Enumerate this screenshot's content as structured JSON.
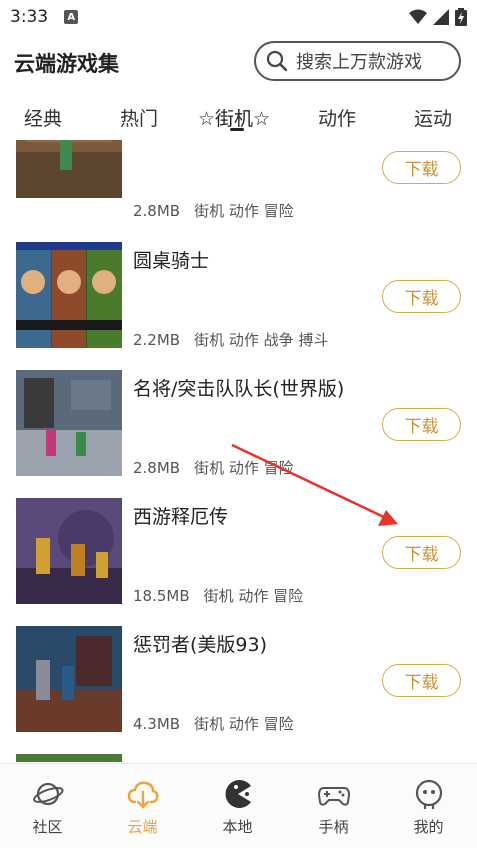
{
  "status_bar": {
    "time": "3:33",
    "notification_glyph": "A"
  },
  "header": {
    "title": "云端游戏集",
    "search_placeholder": "搜索上万款游戏"
  },
  "tabs": [
    {
      "label": "经典"
    },
    {
      "label": "热门"
    },
    {
      "label": "☆街机☆"
    },
    {
      "label": "动作"
    },
    {
      "label": "运动"
    }
  ],
  "games": [
    {
      "name": "",
      "size": "2.8MB",
      "tags": "街机 动作 冒险",
      "download": "下载"
    },
    {
      "name": "圆桌骑士",
      "size": "2.2MB",
      "tags": "街机 动作 战争 搏斗",
      "download": "下载"
    },
    {
      "name": "名将/突击队队长(世界版)",
      "size": "2.8MB",
      "tags": "街机 动作 冒险",
      "download": "下载"
    },
    {
      "name": "西游释厄传",
      "size": "18.5MB",
      "tags": "街机 动作 冒险",
      "download": "下载"
    },
    {
      "name": "惩罚者(美版93)",
      "size": "4.3MB",
      "tags": "街机 动作 冒险",
      "download": "下载"
    },
    {
      "name": "",
      "size": "",
      "tags": "",
      "download": ""
    }
  ],
  "bottom_nav": [
    {
      "label": "社区",
      "icon": "planet-icon"
    },
    {
      "label": "云端",
      "icon": "cloud-download-icon",
      "active": true
    },
    {
      "label": "本地",
      "icon": "pacman-icon"
    },
    {
      "label": "手柄",
      "icon": "gamepad-icon"
    },
    {
      "label": "我的",
      "icon": "face-icon"
    }
  ],
  "colors": {
    "accent": "#f2a23a",
    "download_border": "#d9a85a",
    "arrow": "#e8322c"
  }
}
